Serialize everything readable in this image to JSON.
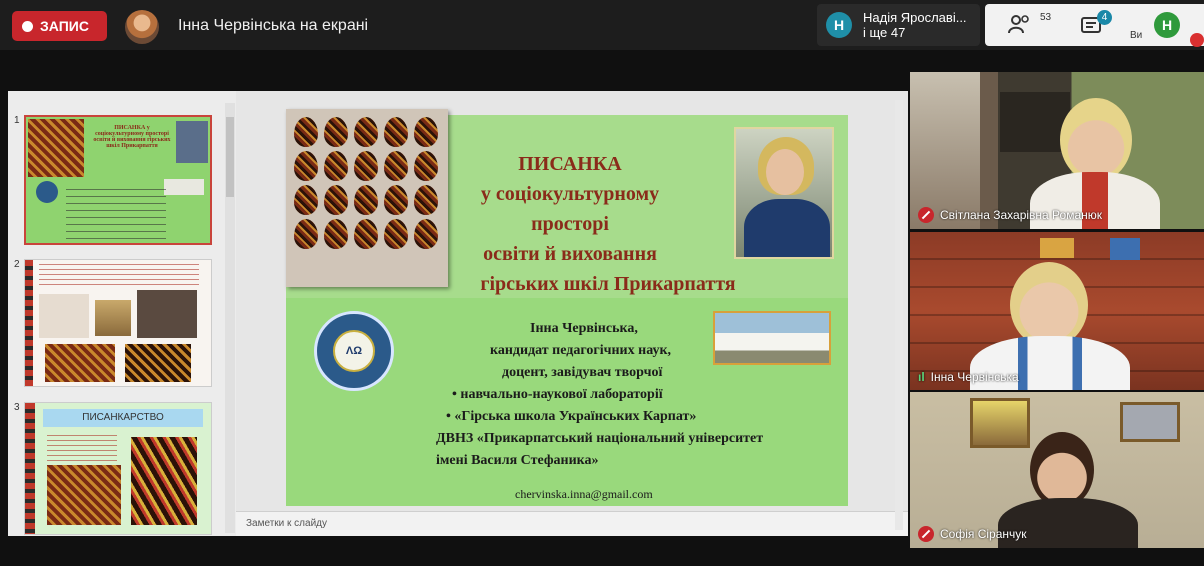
{
  "topbar": {
    "record_label": "ЗАПИС",
    "presenter_text": "Інна Червінська на екрані",
    "participant_initial": "Н",
    "participant_line1": "Надія Ярославі...",
    "participant_line2": "і ще 47",
    "participants_count": "53",
    "chat_badge": "4",
    "self_initial": "Н",
    "self_label": "Ви"
  },
  "thumbnails": {
    "items": [
      {
        "number": "1",
        "title": "ПИСАНКА у соціокультурному просторі освіти й виховання гірських шкіл Прикарпаття"
      },
      {
        "number": "2",
        "title": ""
      },
      {
        "number": "3",
        "title": "ПИСАНКАРСТВО"
      }
    ]
  },
  "slide": {
    "title_lines": [
      "ПИСАНКА",
      "у соціокультурному",
      "просторі",
      "освіти й виховання",
      "гірських шкіл Прикарпаття"
    ],
    "logo_text": "ΛΩ",
    "info": {
      "name": "Інна Червінська,",
      "degree": "кандидат педагогічних наук,",
      "position": "доцент, завідувач творчої",
      "lab": "навчально-наукової лабораторії",
      "school": "«Гірська школа Українських Карпат»",
      "university1": "ДВНЗ «Прикарпатський національний університет",
      "university2": "імені Василя Стефаника»",
      "email": "chervinska.inna@gmail.com"
    }
  },
  "notes_placeholder": "Заметки к слайду",
  "videos": [
    {
      "name": "Світлана Захарівна Романюк",
      "muted": true
    },
    {
      "name": "Інна Червінська",
      "muted": false
    },
    {
      "name": "Софія Сіранчук",
      "muted": true
    }
  ],
  "colors": {
    "record": "#c8262c",
    "slide_green": "#8fd36f",
    "title_red": "#8a2b1a"
  }
}
